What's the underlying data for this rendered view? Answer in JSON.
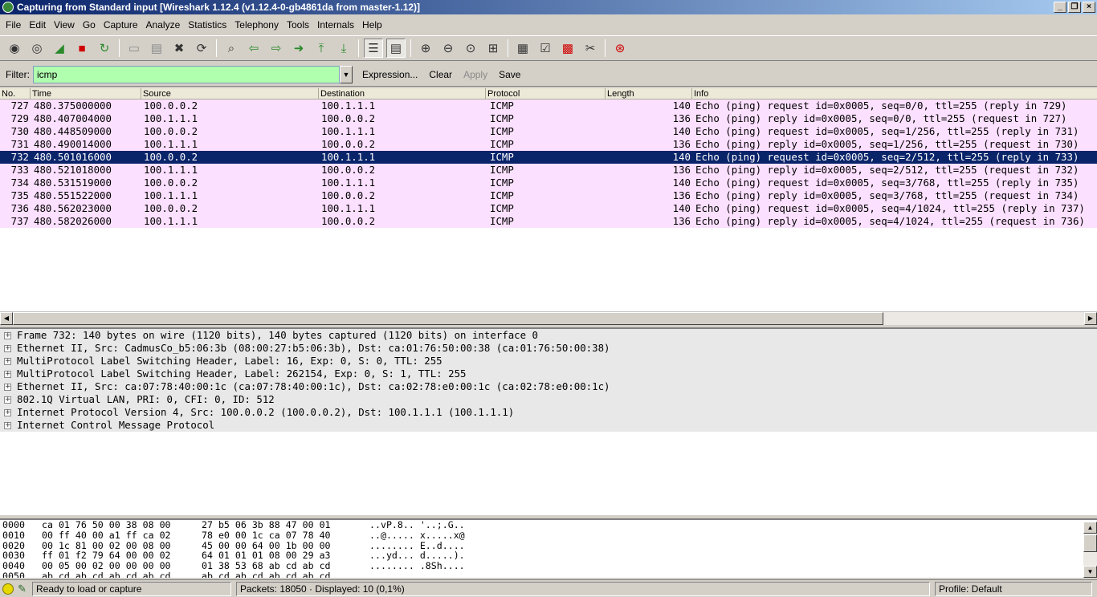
{
  "window": {
    "title": "Capturing from Standard input   [Wireshark 1.12.4  (v1.12.4-0-gb4861da from master-1.12)]"
  },
  "menu": [
    "File",
    "Edit",
    "View",
    "Go",
    "Capture",
    "Analyze",
    "Statistics",
    "Telephony",
    "Tools",
    "Internals",
    "Help"
  ],
  "filter": {
    "label": "Filter:",
    "value": "icmp",
    "expression": "Expression...",
    "clear": "Clear",
    "apply": "Apply",
    "save": "Save",
    "bg_color": "#afffaf"
  },
  "packet_list": {
    "columns": [
      "No.",
      "Time",
      "Source",
      "Destination",
      "Protocol",
      "Length",
      "Info"
    ],
    "row_color": "#fce0ff",
    "selected_color": "#0a246a",
    "rows": [
      {
        "no": "727",
        "time": "480.375000000",
        "src": "100.0.0.2",
        "dst": "100.1.1.1",
        "proto": "ICMP",
        "len": "140",
        "info": "Echo (ping) request  id=0x0005, seq=0/0, ttl=255 (reply in 729)"
      },
      {
        "no": "729",
        "time": "480.407004000",
        "src": "100.1.1.1",
        "dst": "100.0.0.2",
        "proto": "ICMP",
        "len": "136",
        "info": "Echo (ping) reply    id=0x0005, seq=0/0, ttl=255 (request in 727)"
      },
      {
        "no": "730",
        "time": "480.448509000",
        "src": "100.0.0.2",
        "dst": "100.1.1.1",
        "proto": "ICMP",
        "len": "140",
        "info": "Echo (ping) request  id=0x0005, seq=1/256, ttl=255 (reply in 731)"
      },
      {
        "no": "731",
        "time": "480.490014000",
        "src": "100.1.1.1",
        "dst": "100.0.0.2",
        "proto": "ICMP",
        "len": "136",
        "info": "Echo (ping) reply    id=0x0005, seq=1/256, ttl=255 (request in 730)"
      },
      {
        "no": "732",
        "time": "480.501016000",
        "src": "100.0.0.2",
        "dst": "100.1.1.1",
        "proto": "ICMP",
        "len": "140",
        "info": "Echo (ping) request  id=0x0005, seq=2/512, ttl=255 (reply in 733)"
      },
      {
        "no": "733",
        "time": "480.521018000",
        "src": "100.1.1.1",
        "dst": "100.0.0.2",
        "proto": "ICMP",
        "len": "136",
        "info": "Echo (ping) reply    id=0x0005, seq=2/512, ttl=255 (request in 732)"
      },
      {
        "no": "734",
        "time": "480.531519000",
        "src": "100.0.0.2",
        "dst": "100.1.1.1",
        "proto": "ICMP",
        "len": "140",
        "info": "Echo (ping) request  id=0x0005, seq=3/768, ttl=255 (reply in 735)"
      },
      {
        "no": "735",
        "time": "480.551522000",
        "src": "100.1.1.1",
        "dst": "100.0.0.2",
        "proto": "ICMP",
        "len": "136",
        "info": "Echo (ping) reply    id=0x0005, seq=3/768, ttl=255 (request in 734)"
      },
      {
        "no": "736",
        "time": "480.562023000",
        "src": "100.0.0.2",
        "dst": "100.1.1.1",
        "proto": "ICMP",
        "len": "140",
        "info": "Echo (ping) request  id=0x0005, seq=4/1024, ttl=255 (reply in 737)"
      },
      {
        "no": "737",
        "time": "480.582026000",
        "src": "100.1.1.1",
        "dst": "100.0.0.2",
        "proto": "ICMP",
        "len": "136",
        "info": "Echo (ping) reply    id=0x0005, seq=4/1024, ttl=255 (request in 736)"
      }
    ]
  },
  "details": [
    "Frame 732: 140 bytes on wire (1120 bits), 140 bytes captured (1120 bits) on interface 0",
    "Ethernet II, Src: CadmusCo_b5:06:3b (08:00:27:b5:06:3b), Dst: ca:01:76:50:00:38 (ca:01:76:50:00:38)",
    "MultiProtocol Label Switching Header, Label: 16, Exp: 0, S: 0, TTL: 255",
    "MultiProtocol Label Switching Header, Label: 262154, Exp: 0, S: 1, TTL: 255",
    "Ethernet II, Src: ca:07:78:40:00:1c (ca:07:78:40:00:1c), Dst: ca:02:78:e0:00:1c (ca:02:78:e0:00:1c)",
    "802.1Q Virtual LAN, PRI: 0, CFI: 0, ID: 512",
    "Internet Protocol Version 4, Src: 100.0.0.2 (100.0.0.2), Dst: 100.1.1.1 (100.1.1.1)",
    "Internet Control Message Protocol"
  ],
  "bytes": [
    {
      "off": "0000",
      "hex1": "ca 01 76 50 00 38 08 00",
      "hex2": "27 b5 06 3b 88 47 00 01",
      "ascii": "..vP.8.. '..;.G.."
    },
    {
      "off": "0010",
      "hex1": "00 ff 40 00 a1 ff ca 02",
      "hex2": "78 e0 00 1c ca 07 78 40",
      "ascii": "..@..... x.....x@"
    },
    {
      "off": "0020",
      "hex1": "00 1c 81 00 02 00 08 00",
      "hex2": "45 00 00 64 00 1b 00 00",
      "ascii": "........ E..d...."
    },
    {
      "off": "0030",
      "hex1": "ff 01 f2 79 64 00 00 02",
      "hex2": "64 01 01 01 08 00 29 a3",
      "ascii": "...yd... d.....)."
    },
    {
      "off": "0040",
      "hex1": "00 05 00 02 00 00 00 00",
      "hex2": "01 38 53 68 ab cd ab cd",
      "ascii": "........ .8Sh...."
    },
    {
      "off": "0050",
      "hex1": "ab cd ab cd ab cd ab cd",
      "hex2": "ab cd ab cd ab cd ab cd",
      "ascii": "........ ........"
    }
  ],
  "status": {
    "ready": "Ready to load or capture",
    "packets": "Packets: 18050 · Displayed: 10 (0,1%)",
    "profile": "Profile: Default"
  }
}
